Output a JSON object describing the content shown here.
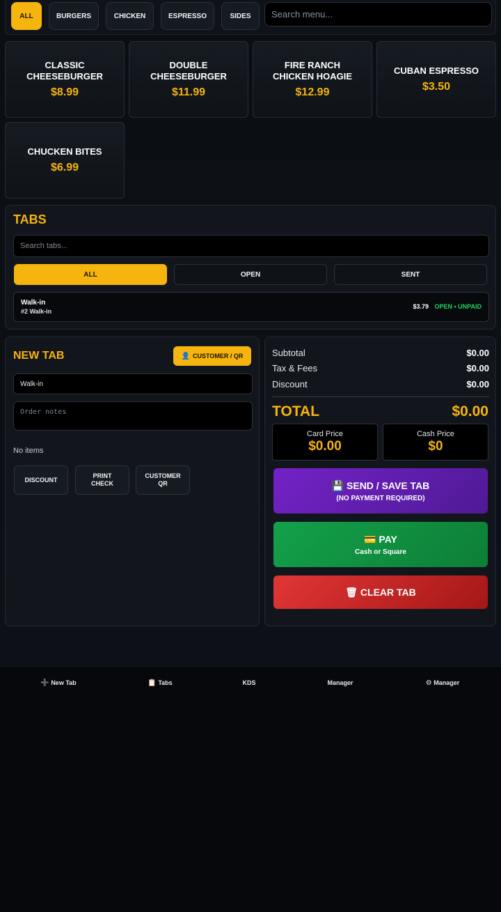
{
  "categories": {
    "items": [
      "ALL",
      "BURGERS",
      "CHICKEN",
      "ESPRESSO",
      "SIDES"
    ],
    "active": "ALL",
    "search_placeholder": "Search menu..."
  },
  "menu": [
    {
      "name": "CLASSIC CHEESEBURGER",
      "price": "$8.99"
    },
    {
      "name": "DOUBLE CHEESEBURGER",
      "price": "$11.99"
    },
    {
      "name": "FIRE RANCH CHICKEN HOAGIE",
      "price": "$12.99"
    },
    {
      "name": "CUBAN ESPRESSO",
      "price": "$3.50"
    },
    {
      "name": "CHUCKEN BITES",
      "price": "$6.99"
    }
  ],
  "tabs": {
    "title": "TABS",
    "search_placeholder": "Search tabs...",
    "filters": [
      "ALL",
      "OPEN",
      "SENT"
    ],
    "active_filter": "ALL",
    "rows": [
      {
        "name": "Walk-in",
        "sub": "#2 Walk-in",
        "amount": "$3.79",
        "status": "OPEN • UNPAID"
      }
    ]
  },
  "new_tab": {
    "title": "NEW TAB",
    "customer_button": "CUSTOMER / QR",
    "customer_icon": "person-icon",
    "name_value": "Walk-in",
    "notes_placeholder": "Order notes",
    "empty_text": "No items",
    "actions": [
      "DISCOUNT",
      "PRINT CHECK",
      "CUSTOMER QR"
    ]
  },
  "totals": {
    "subtotal_label": "Subtotal",
    "subtotal": "$0.00",
    "tax_label": "Tax & Fees",
    "tax": "$0.00",
    "discount_label": "Discount",
    "discount": "$0.00",
    "total_label": "TOTAL",
    "total": "$0.00",
    "card_label": "Card Price",
    "card_price": "$0.00",
    "cash_label": "Cash Price",
    "cash_price": "$0",
    "send_title": "SEND / SAVE TAB",
    "send_sub": "(NO PAYMENT REQUIRED)",
    "pay_title": "PAY",
    "pay_sub": "Cash or Square",
    "clear_title": "CLEAR TAB"
  },
  "nav": [
    {
      "label": "New Tab",
      "icon": "plus-icon"
    },
    {
      "label": "Tabs",
      "icon": "clipboard-icon"
    },
    {
      "label": "KDS",
      "icon": ""
    },
    {
      "label": "Manager",
      "icon": ""
    },
    {
      "label": "Manager",
      "icon": "gear-icon"
    }
  ],
  "colors": {
    "accent": "#f6b40e",
    "send": "#7322c6",
    "pay": "#13a14a",
    "clear": "#e23636",
    "status_open": "#22d35e"
  }
}
